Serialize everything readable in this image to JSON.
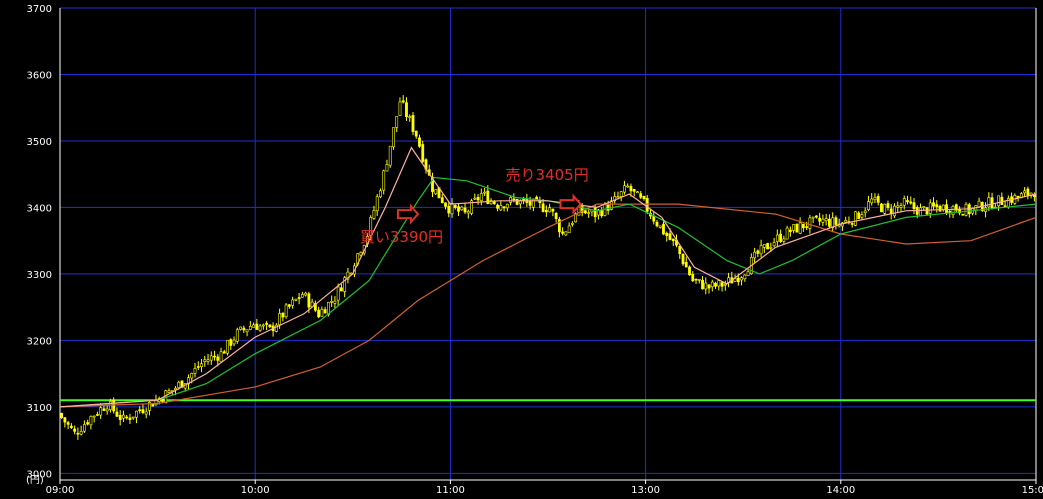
{
  "chart_data": {
    "type": "candlestick",
    "title": "",
    "xlabel": "",
    "ylabel": "",
    "y_unit_label": "(円)",
    "ylim": [
      2990,
      3700
    ],
    "yticks": [
      3000,
      3100,
      3200,
      3300,
      3400,
      3500,
      3600,
      3700
    ],
    "xlim": [
      "09:00",
      "15:00"
    ],
    "x_axis_mode": "session-time (lunch break 11:30–12:30 compressed)",
    "xticks": [
      "09:00",
      "10:00",
      "11:00",
      "13:00",
      "14:00",
      "15:00"
    ],
    "grid": true,
    "colors": {
      "background": "#000000",
      "grid": "#1f2fd6",
      "axis": "#ffffff",
      "candle": "#ffff00",
      "ma_short": "#ffb0a0",
      "ma_mid": "#20c030",
      "ma_long": "#d06030",
      "reference_line": "#40ff20",
      "annotation": "#e0302a"
    },
    "reference_line": {
      "value": 3110
    },
    "price_path": [
      [
        "09:00",
        3090
      ],
      [
        "09:05",
        3060
      ],
      [
        "09:10",
        3085
      ],
      [
        "09:15",
        3105
      ],
      [
        "09:20",
        3080
      ],
      [
        "09:25",
        3095
      ],
      [
        "09:30",
        3110
      ],
      [
        "09:35",
        3125
      ],
      [
        "09:40",
        3145
      ],
      [
        "09:45",
        3170
      ],
      [
        "09:50",
        3180
      ],
      [
        "09:55",
        3210
      ],
      [
        "10:00",
        3225
      ],
      [
        "10:05",
        3215
      ],
      [
        "10:10",
        3245
      ],
      [
        "10:15",
        3270
      ],
      [
        "10:20",
        3240
      ],
      [
        "10:25",
        3265
      ],
      [
        "10:30",
        3310
      ],
      [
        "10:35",
        3360
      ],
      [
        "10:40",
        3450
      ],
      [
        "10:45",
        3560
      ],
      [
        "10:50",
        3510
      ],
      [
        "10:55",
        3430
      ],
      [
        "11:00",
        3400
      ],
      [
        "11:05",
        3390
      ],
      [
        "11:10",
        3420
      ],
      [
        "11:15",
        3405
      ],
      [
        "11:20",
        3410
      ],
      [
        "11:25",
        3405
      ],
      [
        "11:30",
        3400
      ],
      [
        "12:30",
        3410
      ],
      [
        "12:35",
        3360
      ],
      [
        "12:40",
        3395
      ],
      [
        "12:45",
        3390
      ],
      [
        "12:50",
        3405
      ],
      [
        "12:55",
        3430
      ],
      [
        "13:00",
        3405
      ],
      [
        "13:05",
        3370
      ],
      [
        "13:10",
        3340
      ],
      [
        "13:15",
        3290
      ],
      [
        "13:20",
        3280
      ],
      [
        "13:25",
        3285
      ],
      [
        "13:30",
        3300
      ],
      [
        "13:35",
        3330
      ],
      [
        "13:40",
        3350
      ],
      [
        "13:45",
        3365
      ],
      [
        "13:50",
        3375
      ],
      [
        "13:55",
        3380
      ],
      [
        "14:00",
        3375
      ],
      [
        "14:05",
        3385
      ],
      [
        "14:10",
        3410
      ],
      [
        "14:15",
        3395
      ],
      [
        "14:20",
        3405
      ],
      [
        "14:25",
        3395
      ],
      [
        "14:30",
        3400
      ],
      [
        "14:35",
        3400
      ],
      [
        "14:40",
        3395
      ],
      [
        "14:45",
        3405
      ],
      [
        "14:50",
        3410
      ],
      [
        "14:55",
        3415
      ],
      [
        "15:00",
        3425
      ]
    ],
    "ma_short": [
      [
        "09:00",
        3100
      ],
      [
        "09:30",
        3110
      ],
      [
        "09:45",
        3150
      ],
      [
        "10:00",
        3205
      ],
      [
        "10:15",
        3240
      ],
      [
        "10:30",
        3300
      ],
      [
        "10:40",
        3400
      ],
      [
        "10:48",
        3490
      ],
      [
        "10:55",
        3440
      ],
      [
        "11:00",
        3405
      ],
      [
        "11:15",
        3410
      ],
      [
        "11:30",
        3410
      ],
      [
        "12:45",
        3400
      ],
      [
        "12:55",
        3420
      ],
      [
        "13:05",
        3385
      ],
      [
        "13:15",
        3310
      ],
      [
        "13:25",
        3285
      ],
      [
        "13:40",
        3340
      ],
      [
        "14:00",
        3375
      ],
      [
        "14:20",
        3395
      ],
      [
        "14:40",
        3398
      ],
      [
        "15:00",
        3420
      ]
    ],
    "ma_mid": [
      [
        "09:00",
        3100
      ],
      [
        "09:30",
        3110
      ],
      [
        "09:45",
        3135
      ],
      [
        "10:00",
        3180
      ],
      [
        "10:20",
        3230
      ],
      [
        "10:35",
        3290
      ],
      [
        "10:50",
        3410
      ],
      [
        "10:55",
        3445
      ],
      [
        "11:05",
        3440
      ],
      [
        "11:20",
        3415
      ],
      [
        "11:30",
        3410
      ],
      [
        "12:45",
        3395
      ],
      [
        "12:55",
        3405
      ],
      [
        "13:10",
        3370
      ],
      [
        "13:25",
        3320
      ],
      [
        "13:35",
        3300
      ],
      [
        "13:45",
        3320
      ],
      [
        "14:00",
        3360
      ],
      [
        "14:20",
        3385
      ],
      [
        "14:40",
        3395
      ],
      [
        "15:00",
        3405
      ]
    ],
    "ma_long": [
      [
        "09:00",
        3100
      ],
      [
        "09:30",
        3105
      ],
      [
        "10:00",
        3130
      ],
      [
        "10:20",
        3160
      ],
      [
        "10:35",
        3200
      ],
      [
        "10:50",
        3260
      ],
      [
        "11:10",
        3320
      ],
      [
        "11:30",
        3370
      ],
      [
        "12:45",
        3405
      ],
      [
        "13:10",
        3405
      ],
      [
        "13:40",
        3390
      ],
      [
        "14:00",
        3360
      ],
      [
        "14:20",
        3345
      ],
      [
        "14:40",
        3350
      ],
      [
        "15:00",
        3385
      ]
    ],
    "annotations": [
      {
        "text": "買い3390円",
        "x": "10:50",
        "y": 3390,
        "arrow": true
      },
      {
        "text": "売り3405円",
        "x": "12:40",
        "y": 3405,
        "arrow": true
      }
    ]
  }
}
